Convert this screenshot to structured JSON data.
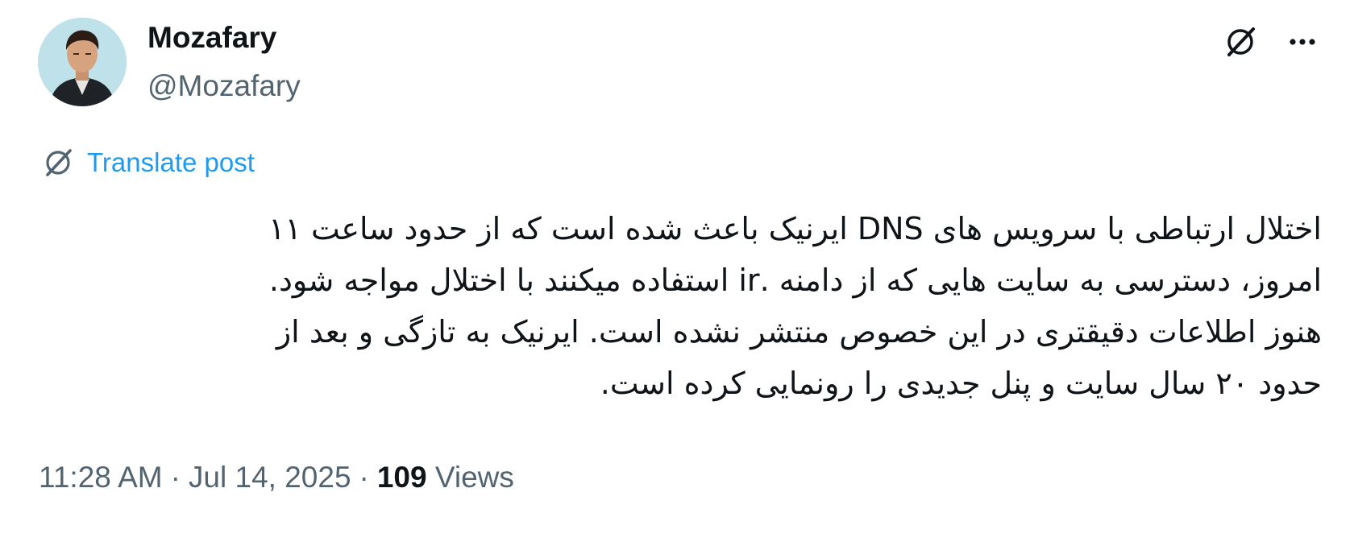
{
  "author": {
    "display_name": "Mozafary",
    "handle": "@Mozafary"
  },
  "icons": {
    "avatar": "profile-photo",
    "grok": "grok-icon",
    "more": "more-dots-icon",
    "translate": "grok-icon"
  },
  "translate": {
    "label": "Translate post"
  },
  "tweet": {
    "lines": [
      "اختلال ارتباطی با سرویس های DNS ایرنیک باعث شده است که از حدود ساعت ۱۱",
      "امروز، دسترسی به سایت هایی که از دامنه .ir استفاده میکنند با اختلال مواجه شود.",
      "هنوز اطلاعات دقیقتری در این خصوص منتشر نشده است. ایرنیک به تازگی و  بعد از",
      "حدود ۲۰ سال سایت و پنل جدیدی را رونمایی کرده است."
    ]
  },
  "meta": {
    "time": "11:28 AM",
    "date": "Jul 14, 2025",
    "separator": "·",
    "views_count": "109",
    "views_label": "Views"
  },
  "colors": {
    "link": "#1d9bf0",
    "secondary_text": "#536471",
    "primary_text": "#0f1419"
  }
}
